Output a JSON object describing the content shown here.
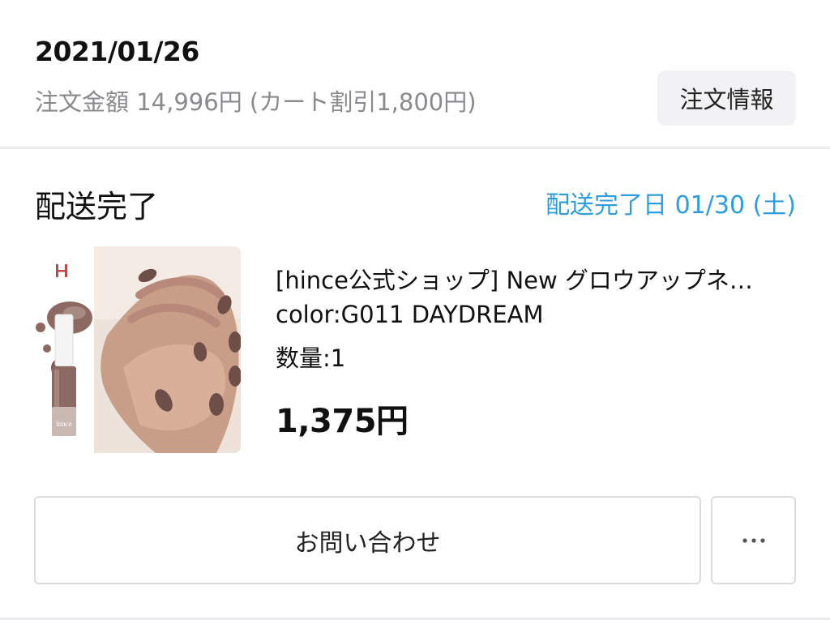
{
  "order": {
    "date": "2021/01/26",
    "amount_text": "注文金額 14,996円 (カート割引1,800円)",
    "info_button_label": "注文情報"
  },
  "delivery": {
    "status": "配送完了",
    "completed_date": "配送完了日 01/30 (土)"
  },
  "product": {
    "name": "[hince公式ショップ] New グロウアップネ…",
    "color": "color:G011 DAYDREAM",
    "quantity": "数量:1",
    "price": "1,375円",
    "thumbnail_brand": "H",
    "bottle_label": "hince"
  },
  "actions": {
    "contact_label": "お問い合わせ",
    "more_label": "more-horizontal-icon"
  },
  "colors": {
    "accent": "#2d9de0",
    "muted_text": "#8a8a8e",
    "button_bg": "#f2f2f4",
    "border": "#dcdcdf"
  }
}
